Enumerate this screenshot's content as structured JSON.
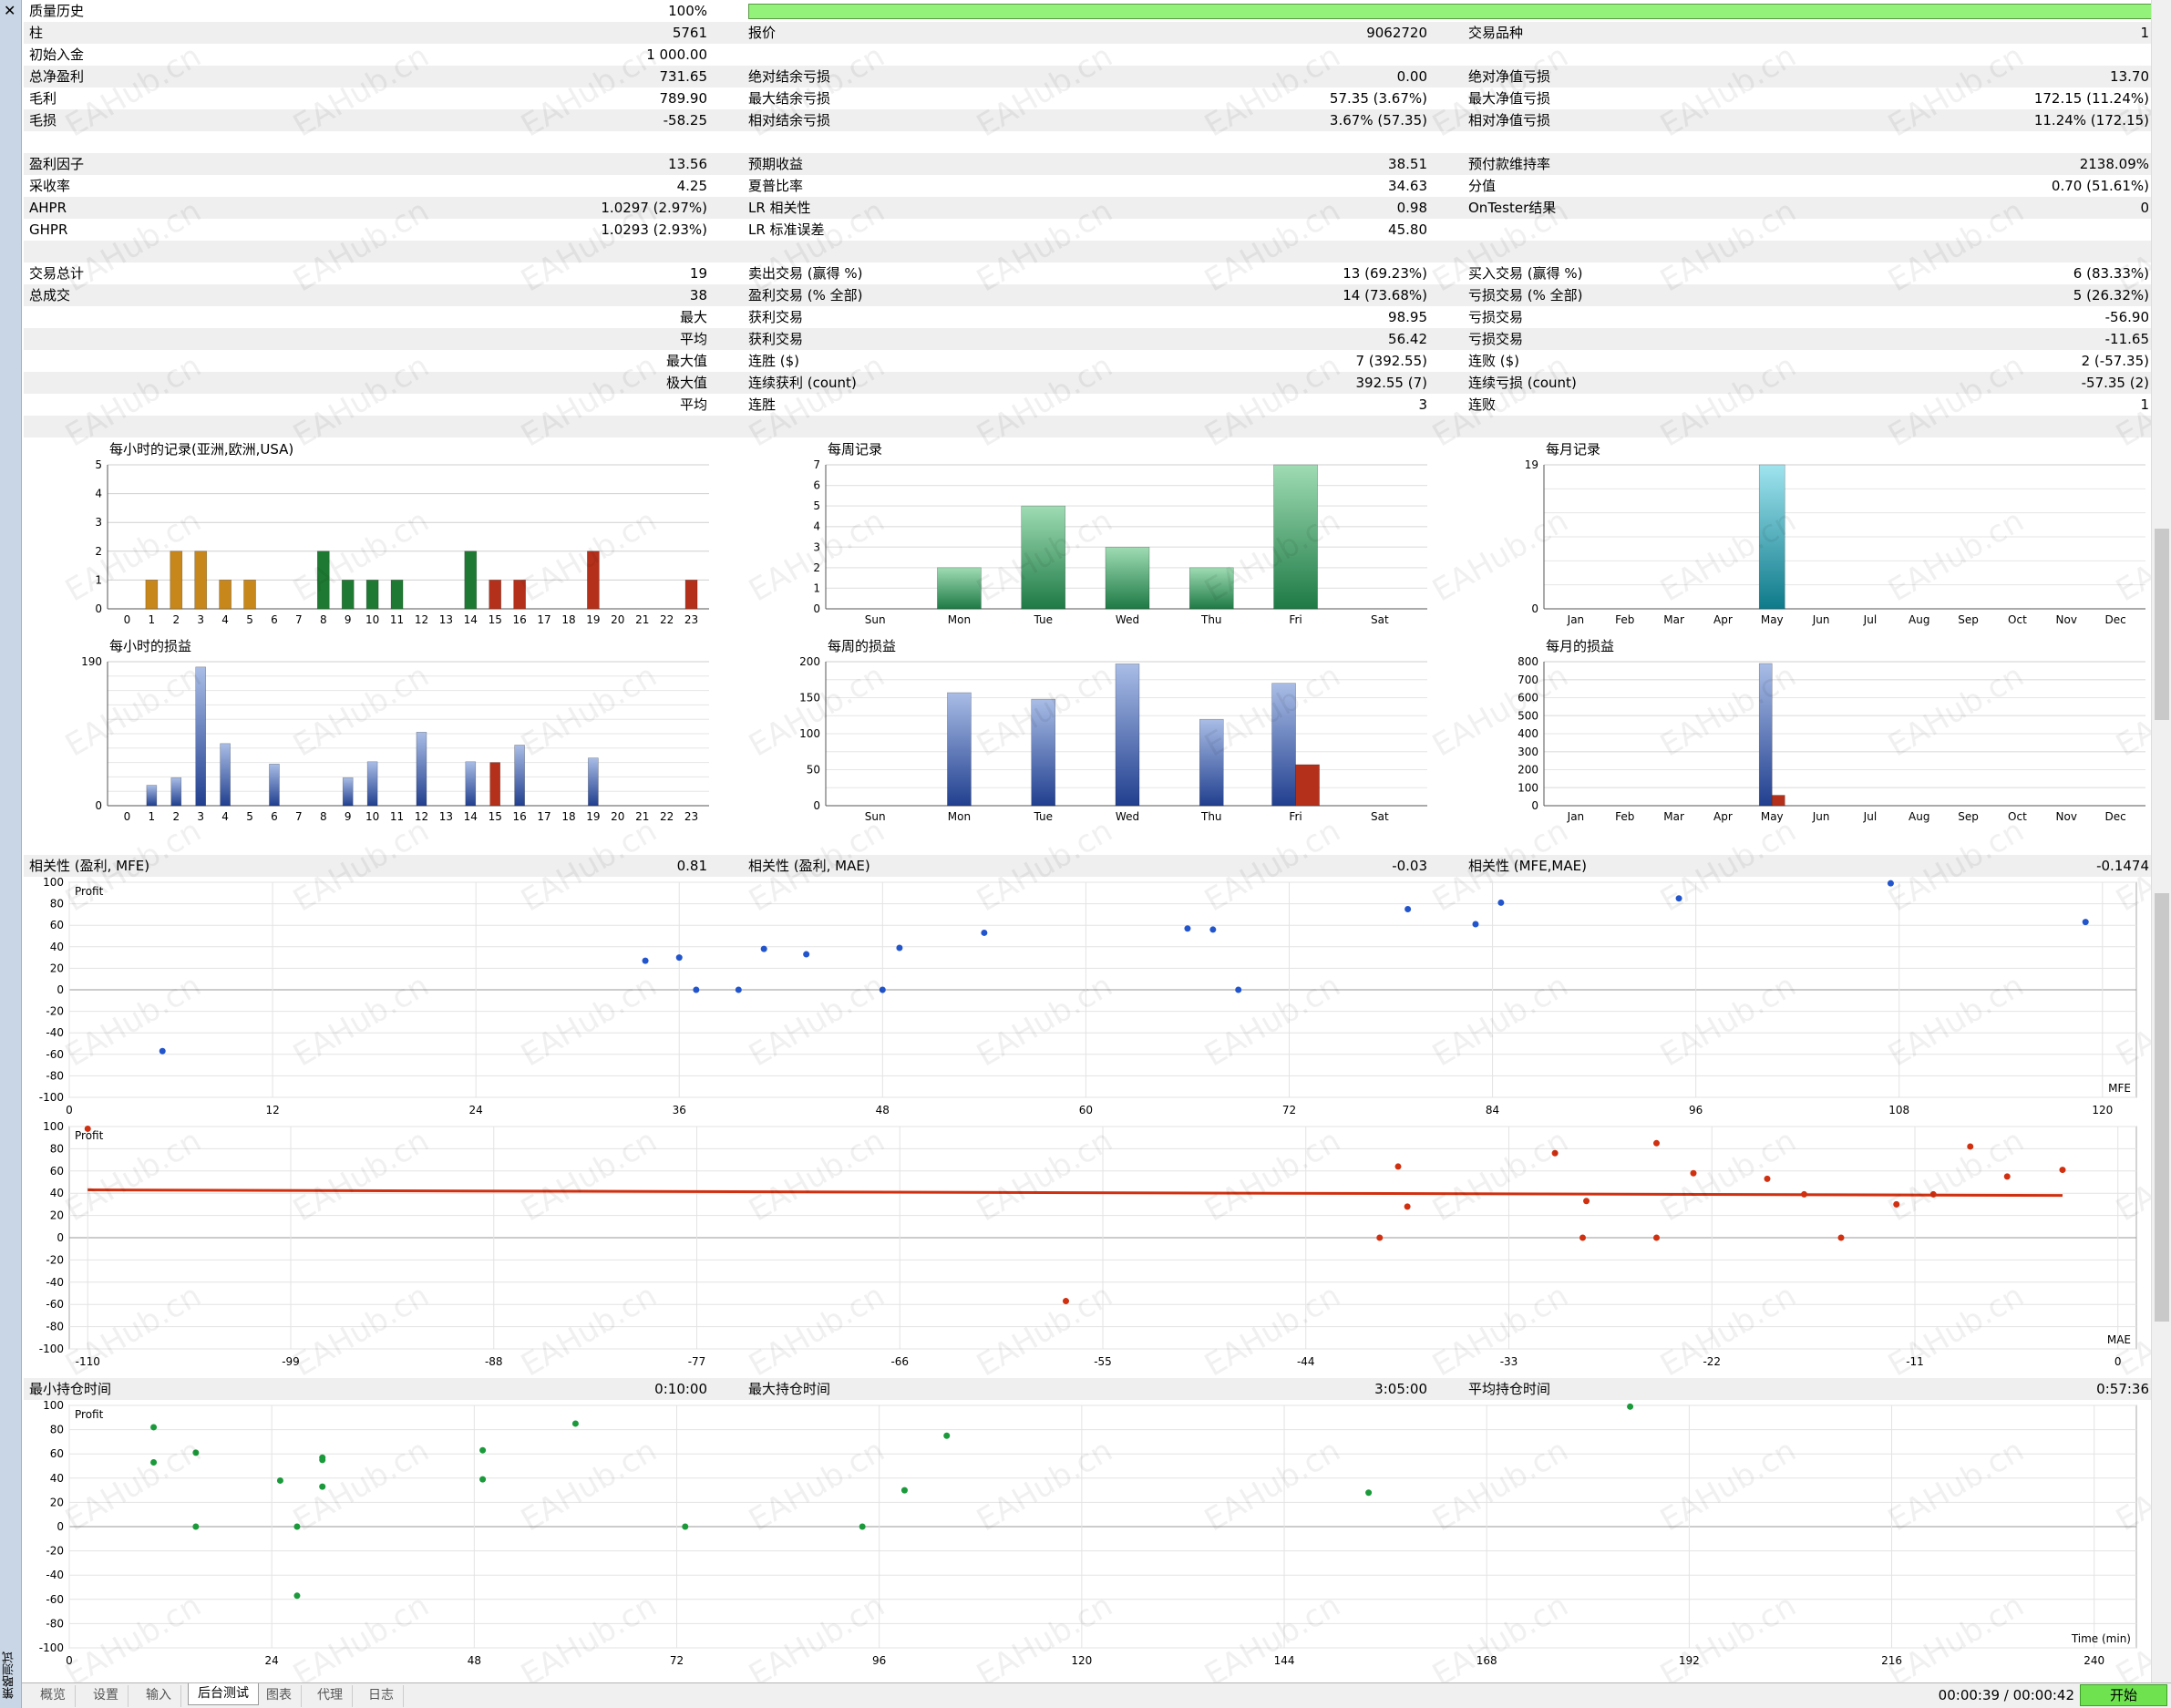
{
  "window": {
    "close_glyph": "✕",
    "vertical_title": "策略测试"
  },
  "header": {
    "history_quality_label": "质量历史",
    "history_quality_value": "100%",
    "history_quality_fraction": 1.0
  },
  "stats": [
    [
      "柱",
      "5761",
      "报价",
      "9062720",
      "交易品种",
      "1"
    ],
    [
      "初始入金",
      "1 000.00",
      "",
      "",
      "",
      ""
    ],
    [
      "总净盈利",
      "731.65",
      "绝对结余亏损",
      "0.00",
      "绝对净值亏损",
      "13.70"
    ],
    [
      "毛利",
      "789.90",
      "最大结余亏损",
      "57.35 (3.67%)",
      "最大净值亏损",
      "172.15 (11.24%)"
    ],
    [
      "毛损",
      "-58.25",
      "相对结余亏损",
      "3.67% (57.35)",
      "相对净值亏损",
      "11.24% (172.15)"
    ],
    [
      "",
      "",
      "",
      "",
      "",
      ""
    ],
    [
      "盈利因子",
      "13.56",
      "预期收益",
      "38.51",
      "预付款维持率",
      "2138.09%"
    ],
    [
      "采收率",
      "4.25",
      "夏普比率",
      "34.63",
      "分值",
      "0.70 (51.61%)"
    ],
    [
      "AHPR",
      "1.0297 (2.97%)",
      "LR 相关性",
      "0.98",
      "OnTester结果",
      "0"
    ],
    [
      "GHPR",
      "1.0293 (2.93%)",
      "LR 标准误差",
      "45.80",
      "",
      ""
    ],
    [
      "",
      "",
      "",
      "",
      "",
      ""
    ],
    [
      "交易总计",
      "19",
      "卖出交易 (赢得 %)",
      "13 (69.23%)",
      "买入交易 (赢得 %)",
      "6 (83.33%)"
    ],
    [
      "总成交",
      "38",
      "盈利交易 (% 全部)",
      "14 (73.68%)",
      "亏损交易 (% 全部)",
      "5 (26.32%)"
    ],
    [
      "",
      "最大",
      "获利交易",
      "98.95",
      "亏损交易",
      "-56.90"
    ],
    [
      "",
      "平均",
      "获利交易",
      "56.42",
      "亏损交易",
      "-11.65"
    ],
    [
      "",
      "最大值",
      "连胜 ($)",
      "7 (392.55)",
      "连败 ($)",
      "2 (-57.35)"
    ],
    [
      "",
      "极大值",
      "连续获利 (count)",
      "392.55 (7)",
      "连续亏损 (count)",
      "-57.35 (2)"
    ],
    [
      "",
      "平均",
      "连胜",
      "3",
      "连败",
      "1"
    ]
  ],
  "correlation": {
    "mfe_label": "相关性 (盈利, MFE)",
    "mfe_value": "0.81",
    "mae_label": "相关性 (盈利, MAE)",
    "mae_value": "-0.03",
    "mfemae_label": "相关性 (MFE,MAE)",
    "mfemae_value": "-0.1474"
  },
  "holding": {
    "min_label": "最小持仓时间",
    "min_value": "0:10:00",
    "max_label": "最大持仓时间",
    "max_value": "3:05:00",
    "avg_label": "平均持仓时间",
    "avg_value": "0:57:36"
  },
  "watermark": "EAHub.cn",
  "colors": {
    "quality_bar": "#92f279",
    "orange": "#c8871a",
    "green": "#1e7a32",
    "red": "#b5301b",
    "blue": "#4466aa",
    "teal": "#1a8fa0",
    "scatter_blue": "#2255cc",
    "scatter_red": "#d03010",
    "scatter_green": "#1a9a3a",
    "start_button": "#6ee24f"
  },
  "chart_data": [
    {
      "id": "hourly_records",
      "type": "bar",
      "title": "每小时的记录(亚洲,欧洲,USA)",
      "categories": [
        "0",
        "1",
        "2",
        "3",
        "4",
        "5",
        "6",
        "7",
        "8",
        "9",
        "10",
        "11",
        "12",
        "13",
        "14",
        "15",
        "16",
        "17",
        "18",
        "19",
        "20",
        "21",
        "22",
        "23"
      ],
      "values": [
        0,
        1,
        2,
        2,
        1,
        1,
        0,
        0,
        2,
        1,
        1,
        1,
        0,
        0,
        2,
        1,
        1,
        0,
        0,
        2,
        0,
        0,
        0,
        1
      ],
      "ylim": [
        0,
        5
      ],
      "yticks": [
        "0",
        "1",
        "2",
        "3",
        "4",
        "5"
      ]
    },
    {
      "id": "weekly_records",
      "type": "bar",
      "title": "每周记录",
      "categories": [
        "Sun",
        "Mon",
        "Tue",
        "Wed",
        "Thu",
        "Fri",
        "Sat"
      ],
      "values": [
        0,
        2,
        5,
        3,
        2,
        7,
        0
      ],
      "ylim": [
        0,
        7
      ],
      "yticks": [
        "0",
        "1",
        "2",
        "3",
        "4",
        "5",
        "6",
        "7"
      ]
    },
    {
      "id": "monthly_records",
      "type": "bar",
      "title": "每月记录",
      "categories": [
        "Jan",
        "Feb",
        "Mar",
        "Apr",
        "May",
        "Jun",
        "Jul",
        "Aug",
        "Sep",
        "Oct",
        "Nov",
        "Dec"
      ],
      "values": [
        0,
        0,
        0,
        0,
        19,
        0,
        0,
        0,
        0,
        0,
        0,
        0
      ],
      "ylim": [
        0,
        19
      ],
      "yticks": [
        "0",
        "19"
      ]
    },
    {
      "id": "hourly_pl",
      "type": "bar",
      "title": "每小时的损益",
      "categories": [
        "0",
        "1",
        "2",
        "3",
        "4",
        "5",
        "6",
        "7",
        "8",
        "9",
        "10",
        "11",
        "12",
        "13",
        "14",
        "15",
        "16",
        "17",
        "18",
        "19",
        "20",
        "21",
        "22",
        "23"
      ],
      "series": [
        {
          "values": [
            0,
            27,
            37,
            183,
            82,
            0,
            55,
            0,
            0,
            37,
            58,
            0,
            97,
            0,
            58,
            0,
            80,
            0,
            0,
            63,
            0,
            0,
            0,
            0
          ]
        },
        {
          "values": [
            0,
            0,
            0,
            0,
            0,
            0,
            0,
            0,
            0,
            0,
            0,
            0,
            0,
            0,
            0,
            57,
            0,
            0,
            0,
            0,
            0,
            0,
            0,
            0
          ]
        }
      ],
      "ylim": [
        0,
        190
      ],
      "yticks": [
        "0",
        "190"
      ]
    },
    {
      "id": "weekly_pl",
      "type": "bar",
      "title": "每周的损益",
      "categories": [
        "Sun",
        "Mon",
        "Tue",
        "Wed",
        "Thu",
        "Fri",
        "Sat"
      ],
      "series": [
        {
          "values": [
            0,
            157,
            148,
            197,
            120,
            170,
            0
          ]
        },
        {
          "values": [
            0,
            0,
            0,
            0,
            0,
            57,
            0
          ]
        }
      ],
      "ylim": [
        0,
        200
      ],
      "yticks": [
        "0",
        "50",
        "100",
        "150",
        "200"
      ]
    },
    {
      "id": "monthly_pl",
      "type": "bar",
      "title": "每月的损益",
      "categories": [
        "Jan",
        "Feb",
        "Mar",
        "Apr",
        "May",
        "Jun",
        "Jul",
        "Aug",
        "Sep",
        "Oct",
        "Nov",
        "Dec"
      ],
      "series": [
        {
          "values": [
            0,
            0,
            0,
            0,
            790,
            0,
            0,
            0,
            0,
            0,
            0,
            0
          ]
        },
        {
          "values": [
            0,
            0,
            0,
            0,
            58,
            0,
            0,
            0,
            0,
            0,
            0,
            0
          ]
        }
      ],
      "ylim": [
        0,
        800
      ],
      "yticks": [
        "0",
        "100",
        "200",
        "300",
        "400",
        "500",
        "600",
        "700",
        "800"
      ]
    },
    {
      "id": "scatter_mfe",
      "type": "scatter",
      "ylabel": "Profit",
      "xlabel": "MFE",
      "xlim": [
        0,
        122
      ],
      "ylim": [
        -100,
        100
      ],
      "xticks": [
        "0",
        "12",
        "24",
        "36",
        "48",
        "60",
        "72",
        "84",
        "96",
        "108",
        "120"
      ],
      "yticks": [
        "100",
        "80",
        "60",
        "40",
        "20",
        "0",
        "-20",
        "-40",
        "-60",
        "-80",
        "-100"
      ],
      "points": [
        [
          5.5,
          -57
        ],
        [
          34,
          27
        ],
        [
          36,
          30
        ],
        [
          37,
          0
        ],
        [
          39.5,
          0
        ],
        [
          41,
          38
        ],
        [
          43.5,
          33
        ],
        [
          48,
          0
        ],
        [
          49,
          39
        ],
        [
          54,
          53
        ],
        [
          66,
          57
        ],
        [
          67.5,
          56
        ],
        [
          69,
          0
        ],
        [
          79,
          75
        ],
        [
          83,
          61
        ],
        [
          84.5,
          81
        ],
        [
          95,
          85
        ],
        [
          107.5,
          99
        ],
        [
          119,
          63
        ]
      ]
    },
    {
      "id": "scatter_mae",
      "type": "scatter",
      "ylabel": "Profit",
      "xlabel": "MAE",
      "xlim": [
        -111,
        1
      ],
      "ylim": [
        -100,
        100
      ],
      "xticks": [
        "-110",
        "-99",
        "-88",
        "-77",
        "-66",
        "-55",
        "-44",
        "-33",
        "-22",
        "-11",
        "0"
      ],
      "yticks": [
        "100",
        "80",
        "60",
        "40",
        "20",
        "0",
        "-20",
        "-40",
        "-60",
        "-80",
        "-100"
      ],
      "points": [
        [
          -110,
          98
        ],
        [
          -57,
          -57
        ],
        [
          -40,
          0
        ],
        [
          -39,
          64
        ],
        [
          -38.5,
          28
        ],
        [
          -30.5,
          76
        ],
        [
          -29,
          0
        ],
        [
          -28.8,
          33
        ],
        [
          -25,
          85
        ],
        [
          -25,
          0
        ],
        [
          -23,
          58
        ],
        [
          -19,
          53
        ],
        [
          -17,
          39
        ],
        [
          -15,
          0
        ],
        [
          -12,
          30
        ],
        [
          -8,
          82
        ],
        [
          -10,
          39
        ],
        [
          -6,
          55
        ],
        [
          -3,
          61
        ]
      ],
      "trend": [
        [
          -110,
          43
        ],
        [
          -3,
          38
        ]
      ]
    },
    {
      "id": "scatter_time",
      "type": "scatter",
      "ylabel": "Profit",
      "xlabel": "Time (min)",
      "xlim": [
        0,
        245
      ],
      "ylim": [
        -100,
        100
      ],
      "xticks": [
        "0",
        "24",
        "48",
        "72",
        "96",
        "120",
        "144",
        "168",
        "192",
        "216",
        "240"
      ],
      "yticks": [
        "100",
        "80",
        "60",
        "40",
        "20",
        "0",
        "-20",
        "-40",
        "-60",
        "-80",
        "-100"
      ],
      "points": [
        [
          10,
          82
        ],
        [
          10,
          53
        ],
        [
          15,
          61
        ],
        [
          15,
          0
        ],
        [
          25,
          38
        ],
        [
          27,
          0
        ],
        [
          27,
          -57
        ],
        [
          30,
          57
        ],
        [
          30,
          55
        ],
        [
          30,
          33
        ],
        [
          49,
          63
        ],
        [
          49,
          39
        ],
        [
          60,
          85
        ],
        [
          73,
          0
        ],
        [
          94,
          0
        ],
        [
          99,
          30
        ],
        [
          104,
          75
        ],
        [
          154,
          28
        ],
        [
          185,
          99
        ]
      ]
    }
  ],
  "tabs": [
    {
      "label": "概览"
    },
    {
      "label": "设置"
    },
    {
      "label": "输入"
    },
    {
      "label": "后台测试",
      "active": true
    },
    {
      "label": "图表"
    },
    {
      "label": "代理"
    },
    {
      "label": "日志"
    }
  ],
  "status": {
    "timer": "00:00:39 / 00:00:42",
    "start_label": "开始"
  }
}
